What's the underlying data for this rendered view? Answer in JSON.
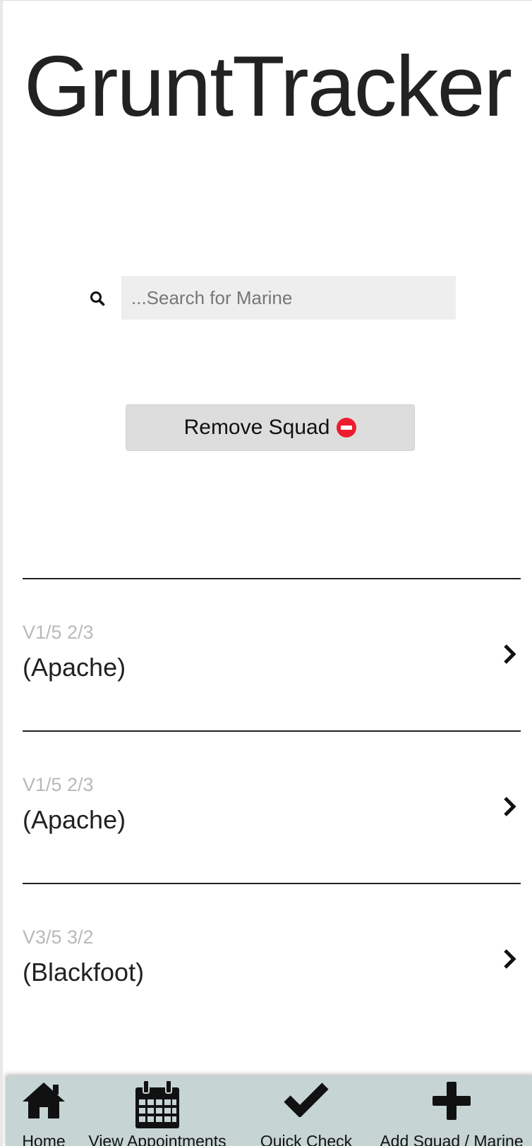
{
  "app": {
    "title": "GruntTracker"
  },
  "search": {
    "placeholder": "...Search for Marine",
    "value": "",
    "icon": "search-icon"
  },
  "actions": {
    "remove_squad_label": "Remove Squad",
    "remove_icon": "minus-circle-icon",
    "remove_icon_color": "#ee1b2e"
  },
  "squads": [
    {
      "code": "V1/5 2/3",
      "name": "(Apache)"
    },
    {
      "code": "V1/5 2/3",
      "name": "(Apache)"
    },
    {
      "code": "V3/5 3/2",
      "name": "(Blackfoot)"
    }
  ],
  "tabbar": {
    "background": "#c7d4d4",
    "tabs": [
      {
        "label": "Home",
        "icon": "home-icon"
      },
      {
        "label": "View Appointments",
        "icon": "calendar-icon"
      },
      {
        "label": "Quick Check",
        "icon": "checkmark-icon"
      },
      {
        "label": "Add Squad / Marine",
        "icon": "plus-icon"
      }
    ]
  }
}
